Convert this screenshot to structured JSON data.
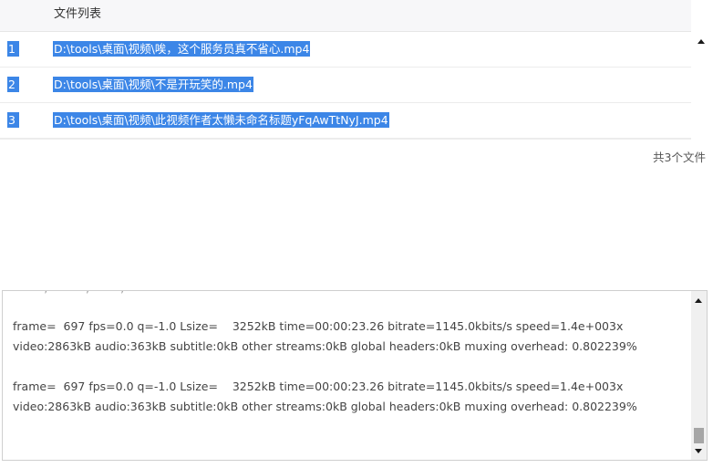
{
  "file_list": {
    "header": "文件列表",
    "rows": [
      {
        "index": "1",
        "path": "D:\\tools\\桌面\\视频\\唉，这个服务员真不省心.mp4"
      },
      {
        "index": "2",
        "path": "D:\\tools\\桌面\\视频\\不是开玩笑的.mp4"
      },
      {
        "index": "3",
        "path": "D:\\tools\\桌面\\视频\\此视频作者太懒未命名标题yFqAwTtNyJ.mp4"
      }
    ],
    "count_text": "共3个文件",
    "selection_color": "#3c86e7"
  },
  "log": {
    "partial_top": "         ,           ,         ,",
    "lines": [
      "frame=  697 fps=0.0 q=-1.0 Lsize=    3252kB time=00:00:23.26 bitrate=1145.0kbits/s speed=1.4e+003x",
      "video:2863kB audio:363kB subtitle:0kB other streams:0kB global headers:0kB muxing overhead: 0.802239%",
      "frame=  697 fps=0.0 q=-1.0 Lsize=    3252kB time=00:00:23.26 bitrate=1145.0kbits/s speed=1.4e+003x",
      "video:2863kB audio:363kB subtitle:0kB other streams:0kB global headers:0kB muxing overhead: 0.802239%"
    ],
    "scroll_position": 0.95
  },
  "icons": {
    "list_scroll_up": "arrow-up-icon",
    "log_scroll_up": "arrow-up-icon",
    "log_scroll_down": "arrow-down-icon"
  }
}
